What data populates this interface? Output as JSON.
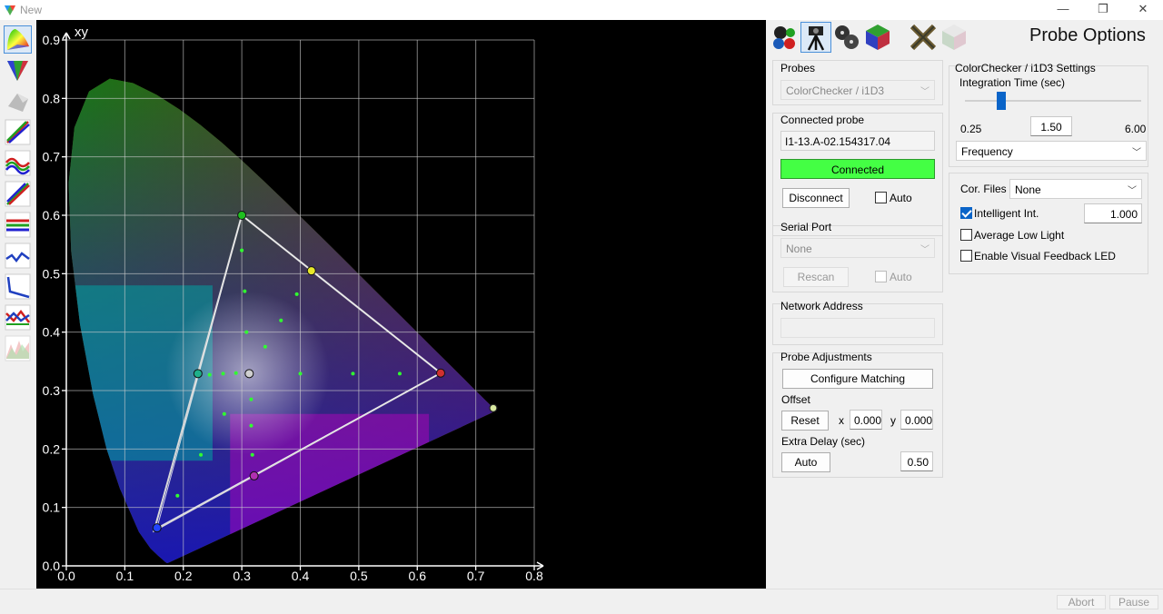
{
  "window": {
    "title": "New",
    "minimize": "—",
    "maximize": "❐",
    "close": "✕"
  },
  "toolbar_left": {
    "tools": [
      {
        "name": "cie-diagram-tool",
        "active": true
      },
      {
        "name": "gamut-triangle-tool",
        "active": false
      },
      {
        "name": "3d-surface-tool",
        "active": false
      },
      {
        "name": "rgb-curves-tool",
        "active": false
      },
      {
        "name": "rgb-balance-tool",
        "active": false
      },
      {
        "name": "gamma-curves-tool",
        "active": false
      },
      {
        "name": "rgb-levels-tool",
        "active": false
      },
      {
        "name": "luminance-curve-tool",
        "active": false
      },
      {
        "name": "delta-e-tool",
        "active": false
      },
      {
        "name": "color-comparison-tool",
        "active": false
      },
      {
        "name": "spectral-tool",
        "active": false
      }
    ]
  },
  "chart_data": {
    "type": "scatter",
    "title": "",
    "xlabel": "",
    "ylabel": "",
    "corner_label": "xy",
    "xlim": [
      0.0,
      0.8
    ],
    "ylim": [
      0.0,
      0.9
    ],
    "x_ticks": [
      "0.0",
      "0.1",
      "0.2",
      "0.3",
      "0.4",
      "0.5",
      "0.6",
      "0.7",
      "0.8"
    ],
    "y_ticks": [
      "0.0",
      "0.1",
      "0.2",
      "0.3",
      "0.4",
      "0.5",
      "0.6",
      "0.7",
      "0.8",
      "0.9"
    ],
    "grid": true,
    "gamut_triangle": [
      [
        0.64,
        0.33
      ],
      [
        0.3,
        0.6
      ],
      [
        0.15,
        0.06
      ]
    ],
    "measured_triangle": [
      [
        0.64,
        0.33
      ],
      [
        0.3,
        0.6
      ],
      [
        0.155,
        0.065
      ]
    ],
    "primaries": [
      {
        "x": 0.3,
        "y": 0.6,
        "color": "#1fbf1f"
      },
      {
        "x": 0.155,
        "y": 0.065,
        "color": "#2244ff"
      },
      {
        "x": 0.64,
        "y": 0.33,
        "color": "#d03030"
      }
    ],
    "secondaries": [
      {
        "x": 0.419,
        "y": 0.505,
        "color": "#e8e82a"
      },
      {
        "x": 0.225,
        "y": 0.329,
        "color": "#1fb08a"
      },
      {
        "x": 0.321,
        "y": 0.154,
        "color": "#b030b0"
      },
      {
        "x": 0.3127,
        "y": 0.329,
        "color": "#d0d0d0"
      }
    ],
    "outside_point": {
      "x": 0.73,
      "y": 0.27,
      "color": "#d8e8a0"
    },
    "saturation_points": [
      {
        "x": 0.3,
        "y": 0.54
      },
      {
        "x": 0.305,
        "y": 0.47
      },
      {
        "x": 0.308,
        "y": 0.4
      },
      {
        "x": 0.19,
        "y": 0.12
      },
      {
        "x": 0.23,
        "y": 0.19
      },
      {
        "x": 0.27,
        "y": 0.26
      },
      {
        "x": 0.318,
        "y": 0.19
      },
      {
        "x": 0.316,
        "y": 0.24
      },
      {
        "x": 0.316,
        "y": 0.285
      },
      {
        "x": 0.245,
        "y": 0.327
      },
      {
        "x": 0.268,
        "y": 0.329
      },
      {
        "x": 0.29,
        "y": 0.33
      },
      {
        "x": 0.4,
        "y": 0.329
      },
      {
        "x": 0.49,
        "y": 0.329
      },
      {
        "x": 0.57,
        "y": 0.329
      },
      {
        "x": 0.34,
        "y": 0.375
      },
      {
        "x": 0.367,
        "y": 0.42
      },
      {
        "x": 0.394,
        "y": 0.465
      }
    ]
  },
  "right_panel": {
    "title": "Probe Options",
    "tab_icons": [
      "rgb-probe-icon",
      "tripod-meter-icon",
      "film-reels-icon",
      "cube-color-icon",
      "close-tools-icon",
      "cube-gray-icon"
    ],
    "probes": {
      "label": "Probes",
      "selected": "ColorChecker / i1D3"
    },
    "connected_probe": {
      "label": "Connected probe",
      "value": "I1-13.A-02.154317.04",
      "status": "Connected",
      "status_color": "#44ff44",
      "disconnect": "Disconnect",
      "auto": "Auto"
    },
    "serial_port": {
      "label": "Serial Port",
      "selected": "None",
      "rescan": "Rescan",
      "auto": "Auto"
    },
    "network_address": {
      "label": "Network Address",
      "value": ""
    },
    "probe_adjustments": {
      "label": "Probe Adjustments",
      "configure": "Configure Matching",
      "offset_label": "Offset",
      "reset": "Reset",
      "x_label": "x",
      "x_value": "0.000",
      "y_label": "y",
      "y_value": "0.000",
      "extra_delay_label": "Extra Delay (sec)",
      "auto": "Auto",
      "delay_value": "0.50"
    },
    "settings": {
      "label": "ColorChecker / i1D3 Settings",
      "integration_label": "Integration Time (sec)",
      "integration_min": "0.25",
      "integration_value": "1.50",
      "integration_max": "6.00",
      "integration_level": 0.217,
      "mode_selected": "Frequency"
    },
    "cor": {
      "label": "Cor. Files",
      "selected": "None",
      "intelligent_label": "Intelligent Int.",
      "intelligent_checked": true,
      "intelligent_value": "1.000",
      "average_low_light": "Average Low Light",
      "visual_feedback": "Enable Visual Feedback LED"
    }
  },
  "status_bar": {
    "abort": "Abort",
    "pause": "Pause"
  }
}
